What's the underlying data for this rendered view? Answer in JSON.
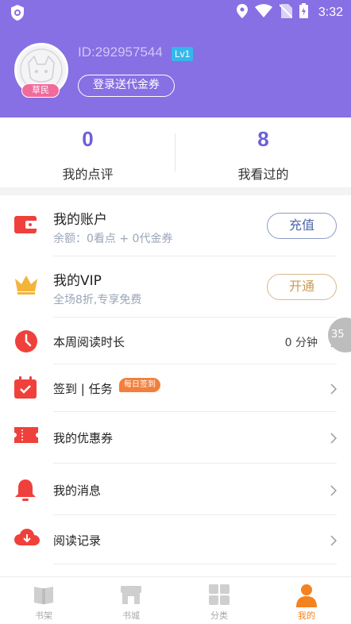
{
  "status_bar": {
    "time": "3:32"
  },
  "profile": {
    "user_id": "ID:292957544",
    "level": "Lv1",
    "rank": "草民",
    "login_button": "登录送代金券"
  },
  "stats": [
    {
      "value": "0",
      "label": "我的点评"
    },
    {
      "value": "8",
      "label": "我看过的"
    }
  ],
  "account": {
    "title": "我的账户",
    "subtitle": "余额：0看点 + 0代金券",
    "button": "充值"
  },
  "vip": {
    "title": "我的VIP",
    "subtitle": "全场8折,专享免费",
    "button": "开通"
  },
  "menu": {
    "reading_time": {
      "label": "本周阅读时长",
      "value": "0 分钟"
    },
    "checkin": {
      "label": "签到 | 任务",
      "badge": "每日签到"
    },
    "coupons": {
      "label": "我的优惠券"
    },
    "messages": {
      "label": "我的消息"
    },
    "history": {
      "label": "阅读记录"
    }
  },
  "floating_bubble": "35",
  "tabs": [
    {
      "label": "书架",
      "active": false
    },
    {
      "label": "书城",
      "active": false
    },
    {
      "label": "分类",
      "active": false
    },
    {
      "label": "我的",
      "active": true
    }
  ],
  "colors": {
    "header": "#8670e3",
    "stat_number": "#6b5fd8",
    "accent_orange": "#f4821f",
    "account_icon": "#f0403c",
    "vip_icon": "#f2b43a",
    "level_badge": "#34b7ec"
  }
}
